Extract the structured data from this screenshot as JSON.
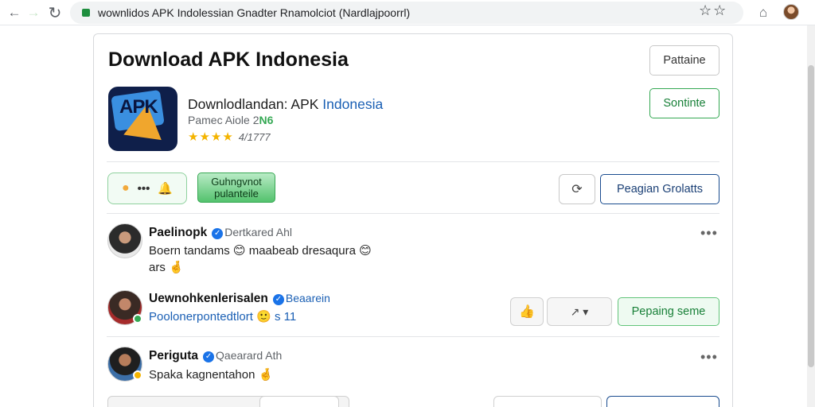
{
  "browser": {
    "url": "wownlidos APK Indolessian Gnadter Rnamolciot (Nardlajpoorrl)"
  },
  "page": {
    "title": "Download APK Indonesia",
    "top_button": "Pattaine"
  },
  "app": {
    "name_main": "Downlodlandan: APK ",
    "name_highlight": "Indonesia",
    "sub_text": "Pamec Aiole 2",
    "sub_accent": "N6",
    "stars": "★★★★",
    "rating": "4/1777",
    "action_button": "Sontinte"
  },
  "actions": {
    "reaction_dots": "•••",
    "green_tag_line1": "Guhngvnot",
    "green_tag_line2": "pulanteile",
    "primary_button": "Peagian Grolatts"
  },
  "comments": [
    {
      "user": "Paelinopk",
      "meta": "Dertkared Ahl",
      "text_line1": "Boern tandams 😊 maabeab dresaqura 😊",
      "text_line2": "ars 🤞"
    },
    {
      "user": "Uewnohkenlerisalen",
      "meta": "Beaarein",
      "text_line1": "Poolonerpontedtlort 🙂 s 11",
      "share_button": "Pepaing seme"
    },
    {
      "user": "Periguta",
      "meta": "Qaearard Ath",
      "text_line1": "Spaka kagnentahon 🤞"
    }
  ],
  "icons": {
    "back": "arrow-left-icon",
    "forward": "arrow-right-icon",
    "reload": "reload-icon",
    "bookmark": "star-icon",
    "home": "home-icon",
    "more": "more-horizontal-icon",
    "like": "thumbs-up-icon"
  },
  "colors": {
    "accent_green": "#34a853",
    "accent_blue": "#1a5fb4",
    "star_gold": "#f4b400"
  }
}
